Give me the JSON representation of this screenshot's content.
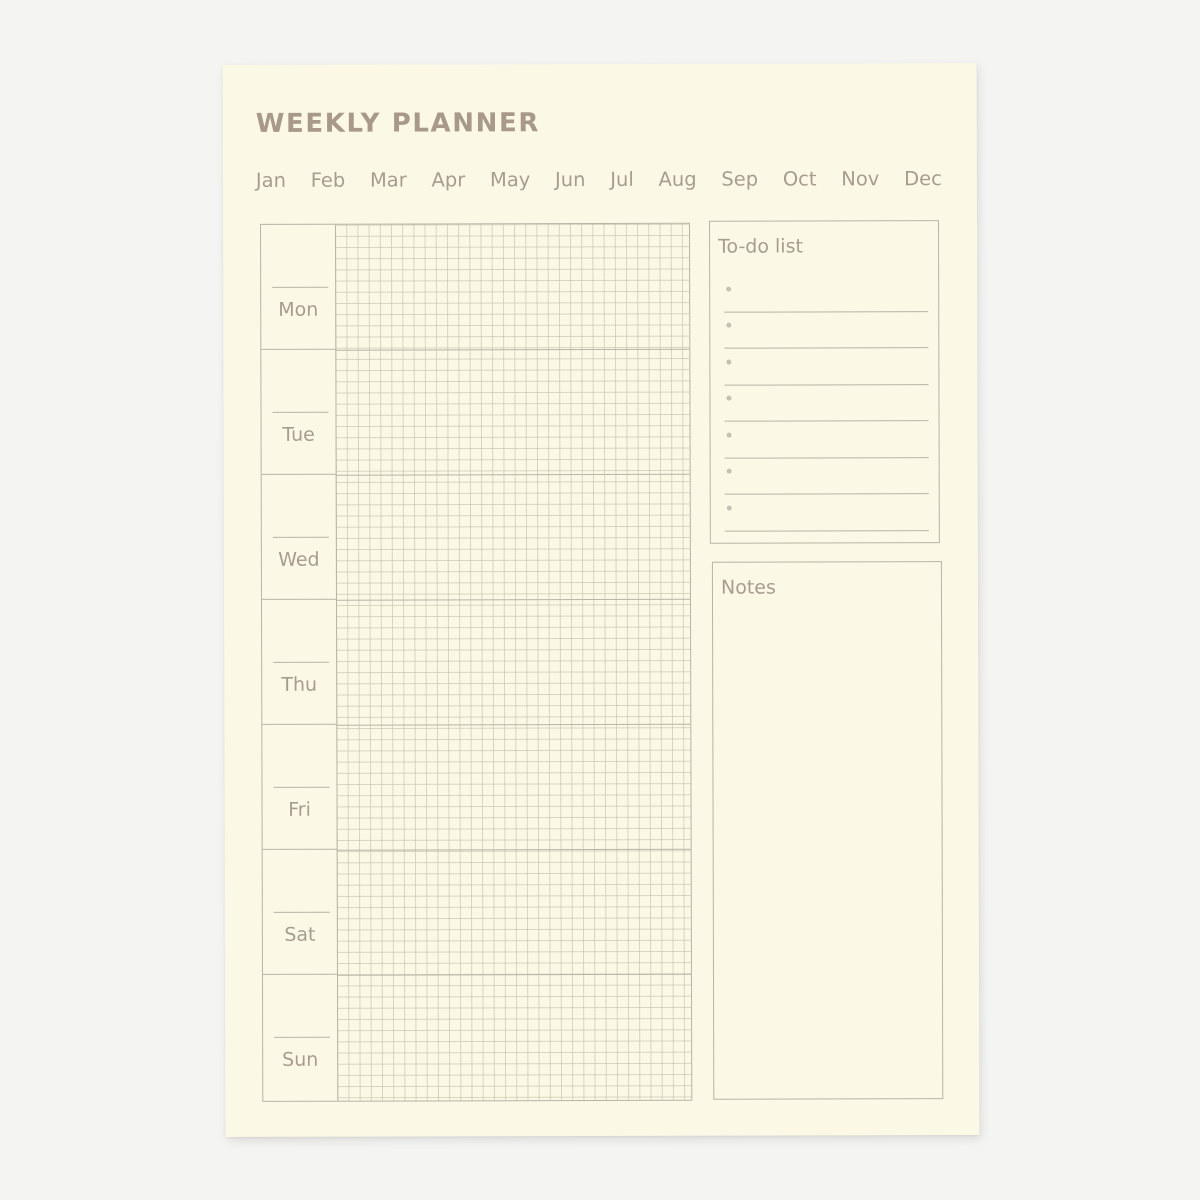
{
  "planner": {
    "title": "WEEKLY PLANNER",
    "months": [
      "Jan",
      "Feb",
      "Mar",
      "Apr",
      "May",
      "Jun",
      "Jul",
      "Aug",
      "Sep",
      "Oct",
      "Nov",
      "Dec"
    ],
    "days": [
      "Mon",
      "Tue",
      "Wed",
      "Thu",
      "Fri",
      "Sat",
      "Sun"
    ]
  },
  "todo": {
    "title": "To-do list",
    "item_count": 7
  },
  "notes": {
    "title": "Notes"
  },
  "colors": {
    "paper": "#fbf8e6",
    "ink": "#a89c8f",
    "rule": "#b8b4a6",
    "background": "#f4f4f2"
  }
}
